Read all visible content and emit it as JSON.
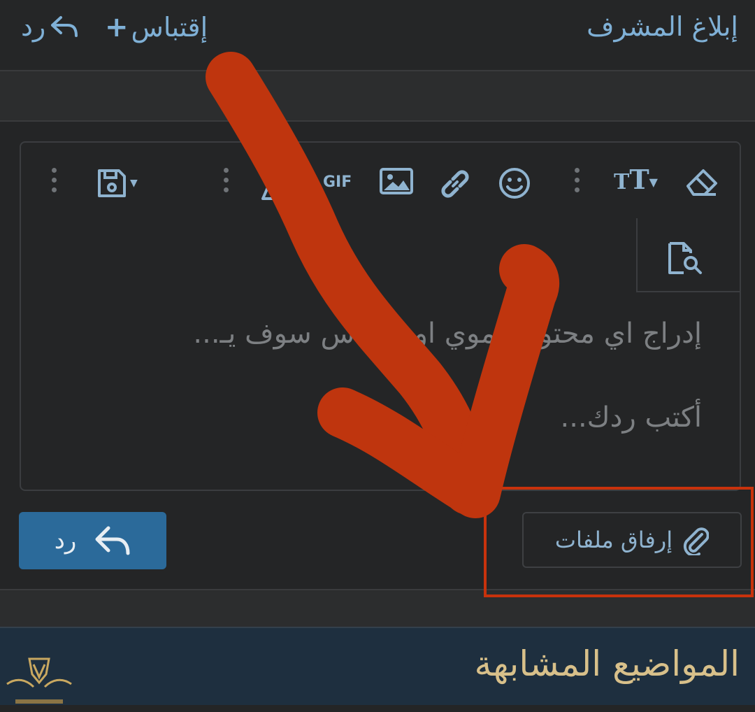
{
  "topbar": {
    "report_label": "إبلاغ المشرف",
    "quote_label": "إقتباس",
    "reply_label": "رد"
  },
  "toolbar": {
    "gif_label": "GIF",
    "icons": [
      "eraser-icon",
      "text-size-icon",
      "more-vertical-icon",
      "emoji-icon",
      "link-icon",
      "image-icon",
      "gif-icon",
      "media-icon",
      "more-vertical-icon",
      "save-draft-icon",
      "more-vertical-icon",
      "preview-icon"
    ]
  },
  "editor": {
    "placeholder_line1": "إدراج اي محتوى دموي او حساس سوف يـ...",
    "placeholder_line2": "أكتب ردك..."
  },
  "actions": {
    "attach_label": "إرفاق ملفات",
    "reply_button_label": "رد"
  },
  "similar": {
    "title": "المواضيع المشابهة"
  },
  "colors": {
    "background": "#242526",
    "accent_link": "#7fb0d6",
    "primary_button": "#2b6a9a",
    "similar_title": "#d8c08a",
    "annotation": "#c0360c"
  }
}
